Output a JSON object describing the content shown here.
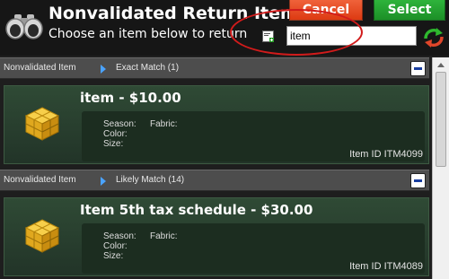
{
  "header": {
    "title": "Nonvalidated Return Item",
    "subtitle": "Choose an item below to return",
    "cancel_label": "Cancel",
    "select_label": "Select",
    "search_value": "item"
  },
  "sections": [
    {
      "breadcrumb_root": "Nonvalidated Item",
      "breadcrumb_leaf": "Exact Match (1)",
      "item": {
        "name": "item - $10.00",
        "season_label": "Season:",
        "fabric_label": "Fabric:",
        "color_label": "Color:",
        "size_label": "Size:",
        "id_text": "Item ID ITM4099"
      }
    },
    {
      "breadcrumb_root": "Nonvalidated Item",
      "breadcrumb_leaf": "Likely Match (14)",
      "item": {
        "name": "Item 5th tax schedule - $30.00",
        "season_label": "Season:",
        "fabric_label": "Fabric:",
        "color_label": "Color:",
        "size_label": "Size:",
        "id_text": "Item ID ITM4089"
      }
    }
  ],
  "icons": {
    "header": "binoculars-icon",
    "scan": "add-item-icon",
    "refresh": "refresh-icon",
    "item": "cube-icon"
  },
  "colors": {
    "cancel": "#dd3a12",
    "select": "#1c8f27",
    "card_bg": "#2a4230",
    "highlight": "#d11b1b"
  }
}
